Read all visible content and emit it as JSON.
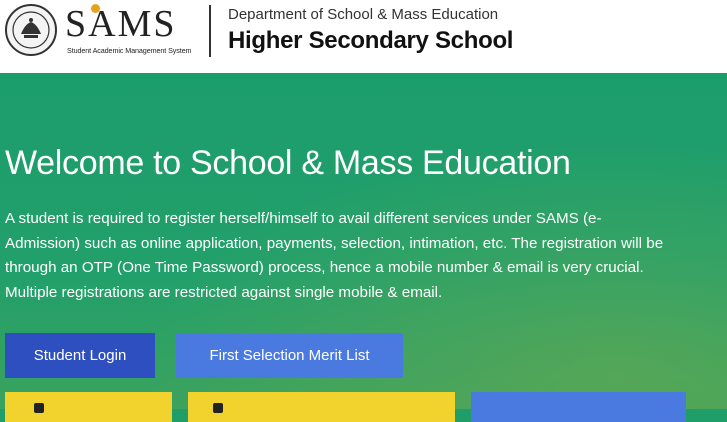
{
  "header": {
    "logo_text": "SAMS",
    "logo_subtitle": "Student Academic Management System",
    "department": "Department of School & Mass Education",
    "school_type": "Higher Secondary School"
  },
  "hero": {
    "welcome": "Welcome to School & Mass Education",
    "paragraph_lines": [
      "A student is required to register herself/himself to avail different services under SAMS (e-",
      "Admission) such as online application, payments, selection, intimation, etc. The registration will be",
      "through an OTP (One Time Password) process, hence a mobile number & email is very crucial.",
      "Multiple registrations are restricted against single mobile & email."
    ]
  },
  "buttons": {
    "student_login": "Student Login",
    "first_merit": "First Selection Merit List"
  },
  "colors": {
    "hero_green": "#1f9e6a",
    "primary_blue": "#2e4fbf",
    "light_blue": "#4a7ae0",
    "yellow": "#f2d22c"
  },
  "icons": {
    "emblem": "odisha-emblem-icon",
    "partial": "info-icon"
  }
}
